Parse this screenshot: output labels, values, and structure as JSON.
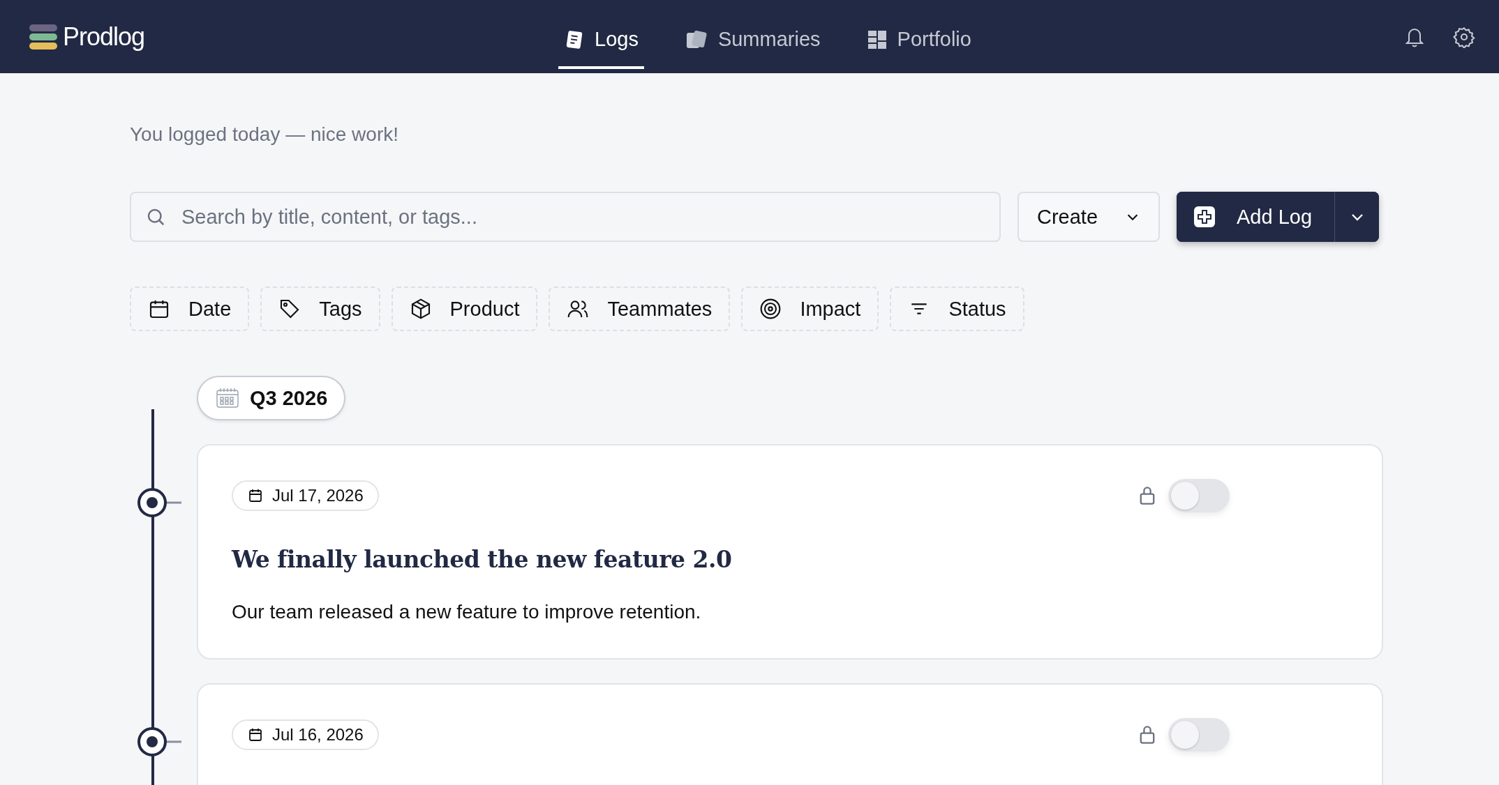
{
  "app": {
    "name": "Prodlog"
  },
  "nav": [
    {
      "label": "Logs",
      "selected": true,
      "kind": "logs"
    },
    {
      "label": "Summaries",
      "selected": false,
      "kind": "summaries"
    },
    {
      "label": "Portfolio",
      "selected": false,
      "kind": "portfolio"
    }
  ],
  "message": "You logged today — nice work!",
  "search": {
    "placeholder": "Search by title, content, or tags..."
  },
  "create_button": "Create",
  "add_button": "Add Log",
  "filters": [
    {
      "label": "Date",
      "kind": "date"
    },
    {
      "label": "Tags",
      "kind": "tags"
    },
    {
      "label": "Product",
      "kind": "product"
    },
    {
      "label": "Teammates",
      "kind": "teammates"
    },
    {
      "label": "Impact",
      "kind": "impact"
    },
    {
      "label": "Status",
      "kind": "status"
    }
  ],
  "timeline": {
    "period": "Q3 2026",
    "logs": [
      {
        "date": "Jul 17, 2026",
        "title": "We finally launched the new feature 2.0",
        "body": "Our team released a new feature to improve retention.",
        "on": false
      },
      {
        "date": "Jul 16, 2026",
        "on": false
      }
    ]
  }
}
